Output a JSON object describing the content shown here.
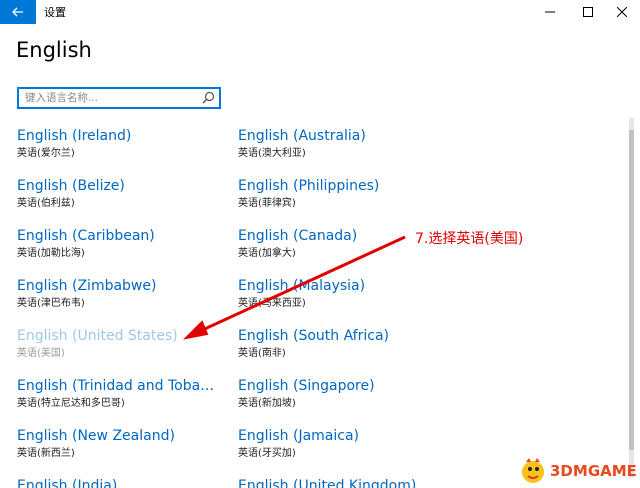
{
  "window": {
    "title": "设置",
    "controls": {
      "minimize": "—",
      "maximize": "☐",
      "close": "✕"
    }
  },
  "page": {
    "title": "English"
  },
  "search": {
    "placeholder": "键入语言名称..."
  },
  "languages": [
    {
      "name": "English (Ireland)",
      "native": "英语(爱尔兰)"
    },
    {
      "name": "English (Australia)",
      "native": "英语(澳大利亚)"
    },
    {
      "name": "English (Belize)",
      "native": "英语(伯利兹)"
    },
    {
      "name": "English (Philippines)",
      "native": "英语(菲律宾)"
    },
    {
      "name": "English (Caribbean)",
      "native": "英语(加勒比海)"
    },
    {
      "name": "English (Canada)",
      "native": "英语(加拿大)"
    },
    {
      "name": "English (Zimbabwe)",
      "native": "英语(津巴布韦)"
    },
    {
      "name": "English (Malaysia)",
      "native": "英语(马来西亚)"
    },
    {
      "name": "English (United States)",
      "native": "英语(美国)",
      "disabled": true
    },
    {
      "name": "English (South Africa)",
      "native": "英语(南非)"
    },
    {
      "name": "English (Trinidad and Tobago)",
      "native": "英语(特立尼达和多巴哥)"
    },
    {
      "name": "English (Singapore)",
      "native": "英语(新加坡)"
    },
    {
      "name": "English (New Zealand)",
      "native": "英语(新西兰)"
    },
    {
      "name": "English (Jamaica)",
      "native": "英语(牙买加)"
    },
    {
      "name": "English (India)",
      "native": ""
    },
    {
      "name": "English (United Kingdom)",
      "native": ""
    }
  ],
  "annotation": {
    "text": "7.选择英语(美国)",
    "color": "#e00000"
  },
  "watermark": {
    "text": "3DMGAME"
  },
  "colors": {
    "accent": "#0078d7",
    "link": "#0067c0",
    "disabled_link": "#9fc7e8"
  }
}
